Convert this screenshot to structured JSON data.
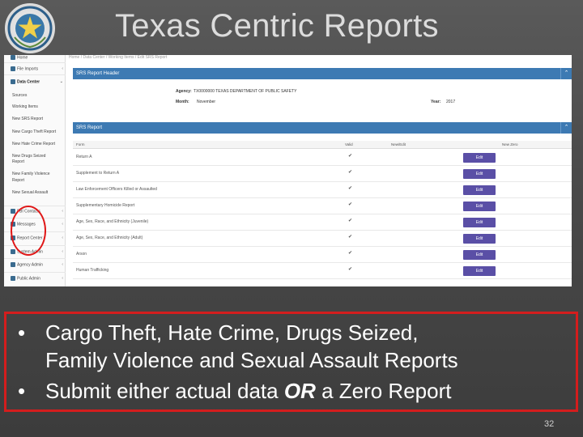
{
  "title": "Texas Centric Reports",
  "app": {
    "breadcrumb": "Home  /  Data Center  /  Working Items  /  Edit SRS Report",
    "sidebar": [
      {
        "label": "Home",
        "icon": "home-icon"
      },
      {
        "label": "File Imports",
        "icon": "upload-icon"
      },
      {
        "label": "Data Center",
        "icon": "database-icon"
      },
      {
        "label": "Sources",
        "sub": true
      },
      {
        "label": "Working Items",
        "sub": true
      },
      {
        "label": "New SRS Report",
        "sub": true
      },
      {
        "label": "New Cargo Theft Report",
        "sub": true
      },
      {
        "label": "New Hate Crime Report",
        "sub": true
      },
      {
        "label": "New Drugs Seized",
        "sub": true
      },
      {
        "label": "Report",
        "sub": true
      },
      {
        "label": "New Family Violence",
        "sub": true
      },
      {
        "label": "Report",
        "sub": true
      },
      {
        "label": "New Sexual Assault",
        "sub": true
      },
      {
        "label": "FBI Contacts",
        "icon": "contacts-icon"
      },
      {
        "label": "Messages",
        "icon": "mail-icon"
      },
      {
        "label": "Report Center",
        "icon": "chart-icon"
      },
      {
        "label": "System Admin",
        "icon": "gear-icon"
      },
      {
        "label": "Agency Admin",
        "icon": "gear-icon"
      },
      {
        "label": "Public Admin",
        "icon": "gear-icon"
      }
    ],
    "header_panel": {
      "title": "SRS Report Header",
      "agency_label": "Agency:",
      "agency_value": "TX0000000 TEXAS DEPARTMENT OF PUBLIC SAFETY",
      "month_label": "Month:",
      "month_value": "November",
      "year_label": "Year:",
      "year_value": "2017"
    },
    "report_panel": {
      "title": "SRS Report",
      "columns": [
        "Form",
        "Valid",
        "New/Edit",
        "New Zero"
      ],
      "rows": [
        {
          "form": "Return A",
          "valid": "✔",
          "action": "Edit"
        },
        {
          "form": "Supplement to Return A",
          "valid": "✔",
          "action": "Edit"
        },
        {
          "form": "Law Enforcement Officers Killed or Assaulted",
          "valid": "✔",
          "action": "Edit"
        },
        {
          "form": "Supplementary Homicide Report",
          "valid": "✔",
          "action": "Edit"
        },
        {
          "form": "Age, Sex, Race, and Ethnicity (Juvenile)",
          "valid": "✔",
          "action": "Edit"
        },
        {
          "form": "Age, Sex, Race, and Ethnicity (Adult)",
          "valid": "✔",
          "action": "Edit"
        },
        {
          "form": "Arson",
          "valid": "✔",
          "action": "Edit"
        },
        {
          "form": "Human Trafficking",
          "valid": "✔",
          "action": "Edit"
        }
      ]
    },
    "collapse_glyph": "⌃"
  },
  "bullets": {
    "b1_line1": "Cargo Theft, Hate Crime, Drugs Seized,",
    "b1_line2": "Family Violence and Sexual Assault Reports",
    "b2_pre": "Submit either actual data ",
    "b2_em": "OR",
    "b2_post": " a Zero Report",
    "dot": "•"
  },
  "page_number": "32",
  "colors": {
    "accent": "#3d7ab3",
    "edit_button": "#5a4fa6",
    "highlight": "#d41d1d"
  }
}
